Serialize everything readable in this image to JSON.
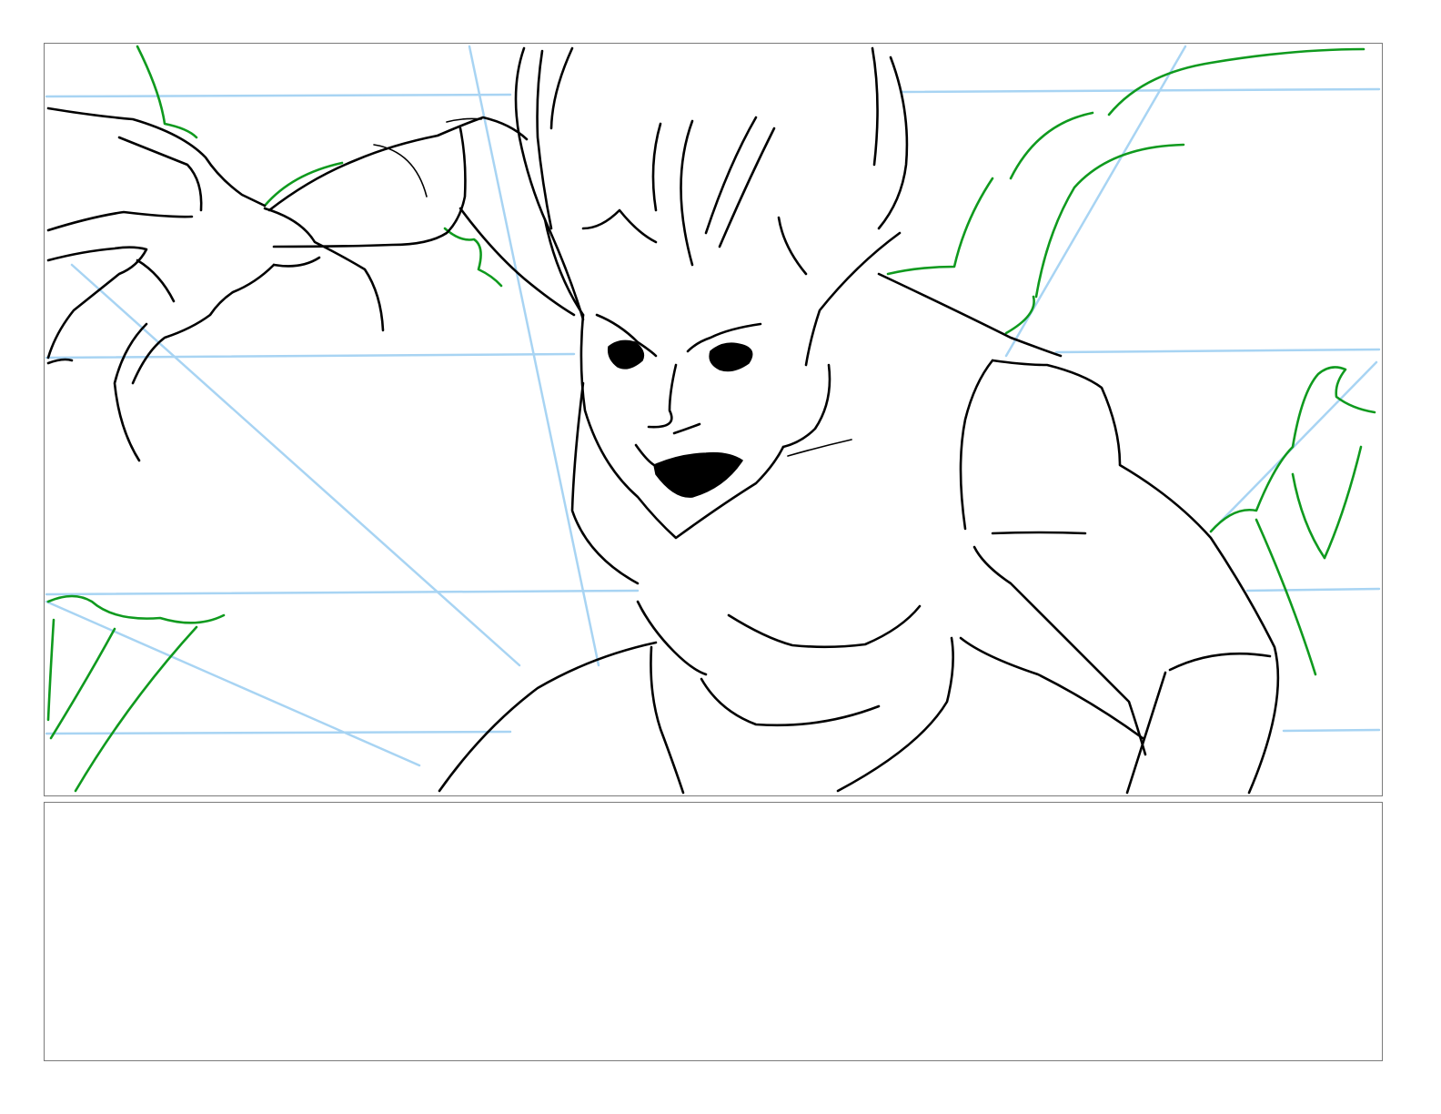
{
  "storyboard": {
    "panels": [
      {
        "id": "panel-1",
        "content": "sketch"
      },
      {
        "id": "panel-2",
        "content": "empty"
      }
    ],
    "colors": {
      "border": "#7a7a7a",
      "perspective_guides": "#a8d4f3",
      "background_sketch": "#0f9a1e",
      "character_lineart": "#000000"
    },
    "icons": [
      "vampire-character-sketch"
    ]
  }
}
